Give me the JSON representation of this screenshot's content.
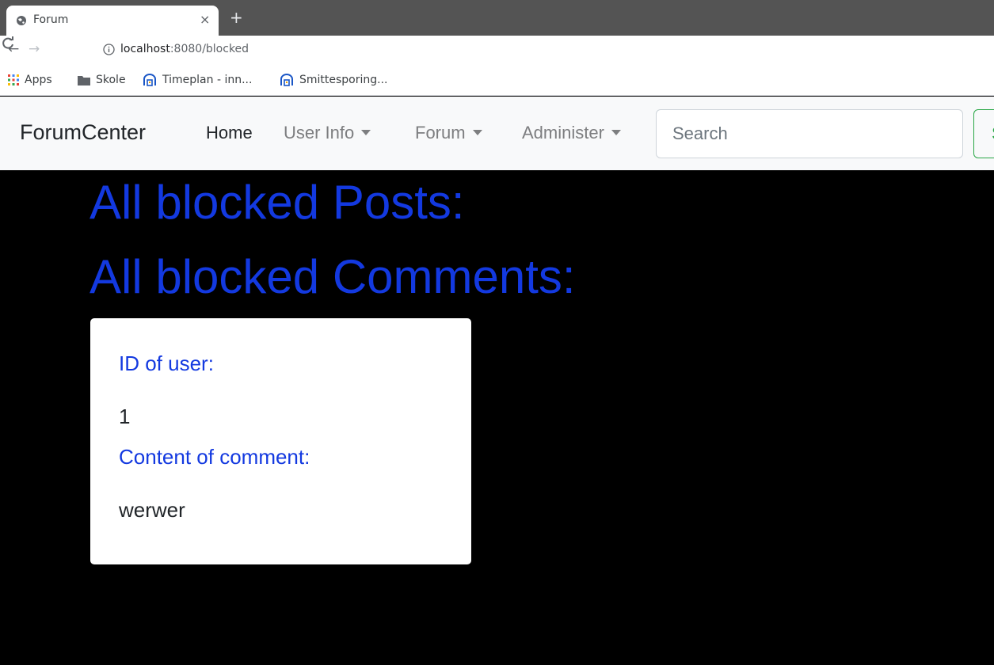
{
  "browser": {
    "tab_title": "Forum",
    "tab_close": "×",
    "new_tab": "+",
    "url_host": "localhost",
    "url_rest": ":8080/blocked",
    "bookmarks": [
      {
        "label": "Apps",
        "icon": "apps-grid-icon"
      },
      {
        "label": "Skole",
        "icon": "folder-icon"
      },
      {
        "label": "Timeplan - inn...",
        "icon": "site-icon"
      },
      {
        "label": "Smittesporing...",
        "icon": "site-icon"
      }
    ]
  },
  "navbar": {
    "brand": "ForumCenter",
    "links": [
      {
        "label": "Home",
        "active": true,
        "dropdown": false
      },
      {
        "label": "User Info",
        "active": false,
        "dropdown": true
      },
      {
        "label": "Forum",
        "active": false,
        "dropdown": true
      },
      {
        "label": "Administer",
        "active": false,
        "dropdown": true
      }
    ],
    "search_placeholder": "Search",
    "search_button": "S"
  },
  "main": {
    "posts_heading": "All blocked Posts:",
    "comments_heading": "All blocked Comments:",
    "comments": [
      {
        "user_id_label": "ID of user:",
        "user_id": "1",
        "content_label": "Content of comment:",
        "content": "werwer"
      }
    ]
  },
  "colors": {
    "heading_blue": "#1339e0",
    "page_background": "#000000",
    "navbar_background": "#f8f9fa",
    "search_button_green": "#28a745"
  }
}
